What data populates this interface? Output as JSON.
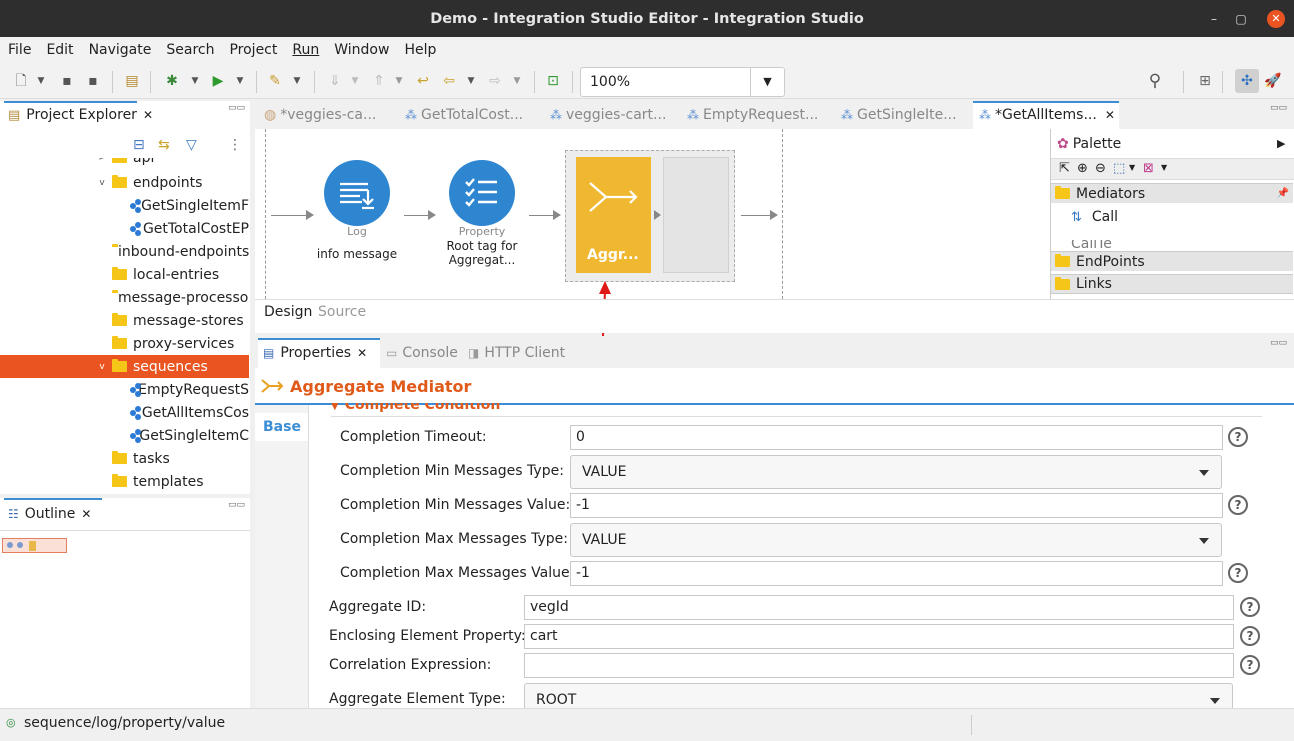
{
  "window": {
    "title": "Demo - Integration Studio Editor - Integration Studio",
    "min": "–",
    "max": "▢",
    "close": "✕"
  },
  "menu": [
    "File",
    "Edit",
    "Navigate",
    "Search",
    "Project",
    "Run",
    "Window",
    "Help"
  ],
  "toolbar": {
    "zoom_value": "100%"
  },
  "project_explorer": {
    "title": "Project Explorer",
    "items": [
      {
        "label": "api",
        "type": "folder",
        "level": 1,
        "twisty": ">"
      },
      {
        "label": "endpoints",
        "type": "folder",
        "level": 1,
        "twisty": "v"
      },
      {
        "label": "GetSingleItemF",
        "type": "seq",
        "level": 2
      },
      {
        "label": "GetTotalCostEP",
        "type": "seq",
        "level": 2
      },
      {
        "label": "inbound-endpoints",
        "type": "folder",
        "level": 1
      },
      {
        "label": "local-entries",
        "type": "folder",
        "level": 1
      },
      {
        "label": "message-processors",
        "type": "folder",
        "level": 1
      },
      {
        "label": "message-stores",
        "type": "folder",
        "level": 1
      },
      {
        "label": "proxy-services",
        "type": "folder",
        "level": 1
      },
      {
        "label": "sequences",
        "type": "folder",
        "level": 1,
        "twisty": "v",
        "selected": true
      },
      {
        "label": "EmptyRequestS",
        "type": "seq",
        "level": 2
      },
      {
        "label": "GetAllItemsCos",
        "type": "seq",
        "level": 2
      },
      {
        "label": "GetSingleItemC",
        "type": "seq",
        "level": 2
      },
      {
        "label": "tasks",
        "type": "folder",
        "level": 1
      },
      {
        "label": "templates",
        "type": "folder",
        "level": 1
      }
    ]
  },
  "outline": {
    "title": "Outline"
  },
  "editor_tabs": [
    {
      "label": "*veggies-ca...",
      "active": false
    },
    {
      "label": "GetTotalCost...",
      "active": false
    },
    {
      "label": "veggies-cart...",
      "active": false
    },
    {
      "label": "EmptyRequest...",
      "active": false
    },
    {
      "label": "GetSingleIte...",
      "active": false
    },
    {
      "label": "*GetAllItems...",
      "active": true
    }
  ],
  "canvas": {
    "log": {
      "type_label": "Log",
      "desc": "info message"
    },
    "property": {
      "type_label": "Property",
      "desc_line1": "Root tag for",
      "desc_line2": "Aggregat..."
    },
    "aggregate": {
      "label": "Aggr..."
    }
  },
  "editor_modes": {
    "design": "Design",
    "source": "Source"
  },
  "palette": {
    "title": "Palette",
    "sections": {
      "mediators": "Mediators",
      "endpoints": "EndPoints",
      "links": "Links"
    },
    "items": {
      "call": "Call",
      "call_template": "CallTe"
    }
  },
  "bottom_tabs": {
    "properties": "Properties",
    "console": "Console",
    "http_client": "HTTP Client"
  },
  "properties": {
    "title": "Aggregate Mediator",
    "side_tab": "Base",
    "section": "Complete Condition",
    "fields": {
      "completion_timeout": {
        "label": "Completion Timeout:",
        "value": "0"
      },
      "min_type": {
        "label": "Completion Min Messages Type:",
        "value": "VALUE"
      },
      "min_value": {
        "label": "Completion Min Messages Value:",
        "value": "-1"
      },
      "max_type": {
        "label": "Completion Max Messages Type:",
        "value": "VALUE"
      },
      "max_value": {
        "label": "Completion Max Messages Value:",
        "value": "-1"
      },
      "aggregate_id": {
        "label": "Aggregate ID:",
        "value": "vegId"
      },
      "enclosing": {
        "label": "Enclosing Element Property:",
        "value": "cart"
      },
      "correlation": {
        "label": "Correlation Expression:",
        "value": ""
      },
      "element_type": {
        "label": "Aggregate Element Type:",
        "value": "ROOT"
      }
    },
    "help": "?"
  },
  "status": {
    "text": "sequence/log/property/value"
  }
}
